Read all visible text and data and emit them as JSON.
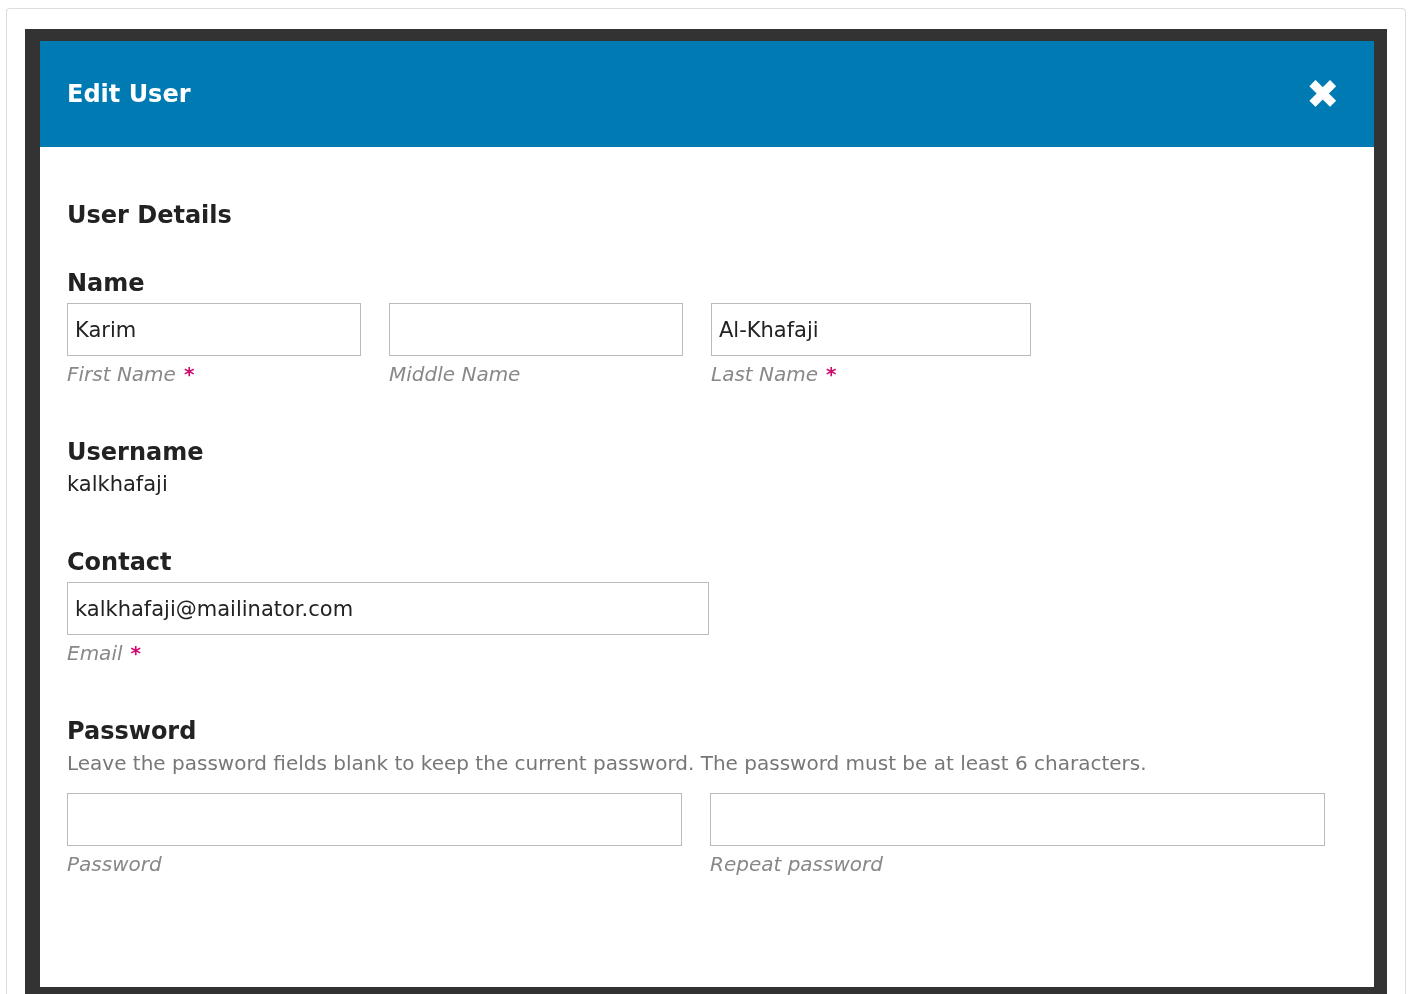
{
  "modal": {
    "title": "Edit User",
    "close_label": "✖"
  },
  "sections": [
    {
      "heading": "User Details",
      "kind": "title"
    },
    {
      "heading": "Name",
      "kind": "fields",
      "fields": [
        {
          "value": "Karim",
          "label": "First Name",
          "required": true
        },
        {
          "label": "Middle Name",
          "required": false
        },
        {
          "value": "Al-Khafaji",
          "label": "Last Name",
          "required": true
        }
      ]
    },
    {
      "heading": "Username",
      "kind": "text",
      "text": "kalkhafaji"
    },
    {
      "heading": "Contact",
      "kind": "fields",
      "fields": [
        {
          "value": "kalkhafaji@mailinator.com",
          "label": "Email",
          "required": true
        }
      ]
    },
    {
      "heading": "Password",
      "kind": "fields",
      "description": "Leave the password fields blank to keep the current password. The password must be at least 6 characters.",
      "fields": [
        {
          "label": "Password",
          "required": false
        },
        {
          "label": "Repeat password",
          "required": false
        }
      ]
    }
  ],
  "required_mark": "*"
}
